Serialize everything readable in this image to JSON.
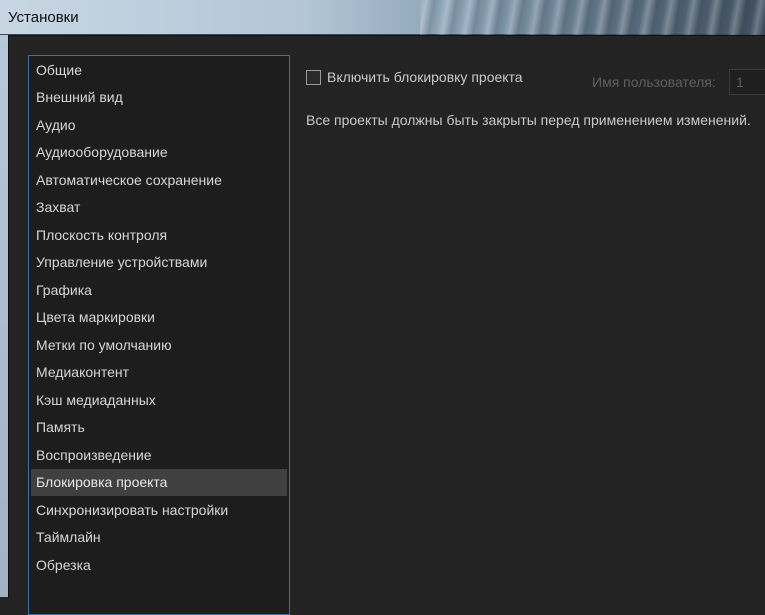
{
  "window": {
    "title": "Установки"
  },
  "sidebar": {
    "items": [
      {
        "label": "Общие"
      },
      {
        "label": "Внешний вид"
      },
      {
        "label": "Аудио"
      },
      {
        "label": "Аудиооборудование"
      },
      {
        "label": "Автоматическое сохранение"
      },
      {
        "label": "Захват"
      },
      {
        "label": "Плоскость контроля"
      },
      {
        "label": "Управление устройствами"
      },
      {
        "label": "Графика"
      },
      {
        "label": "Цвета маркировки"
      },
      {
        "label": "Метки по умолчанию"
      },
      {
        "label": "Медиаконтент"
      },
      {
        "label": "Кэш медиаданных"
      },
      {
        "label": "Память"
      },
      {
        "label": "Воспроизведение"
      },
      {
        "label": "Блокировка проекта",
        "selected": true
      },
      {
        "label": "Синхронизировать настройки"
      },
      {
        "label": "Таймлайн"
      },
      {
        "label": "Обрезка"
      }
    ]
  },
  "panel": {
    "enable_lock_label": "Включить блокировку проекта",
    "enable_lock_checked": false,
    "username_label": "Имя пользователя:",
    "username_value": "1",
    "note": "Все проекты должны быть закрыты перед применением изменений."
  },
  "colors": {
    "selection": "#404040",
    "focus_border": "#3f6ea8"
  }
}
